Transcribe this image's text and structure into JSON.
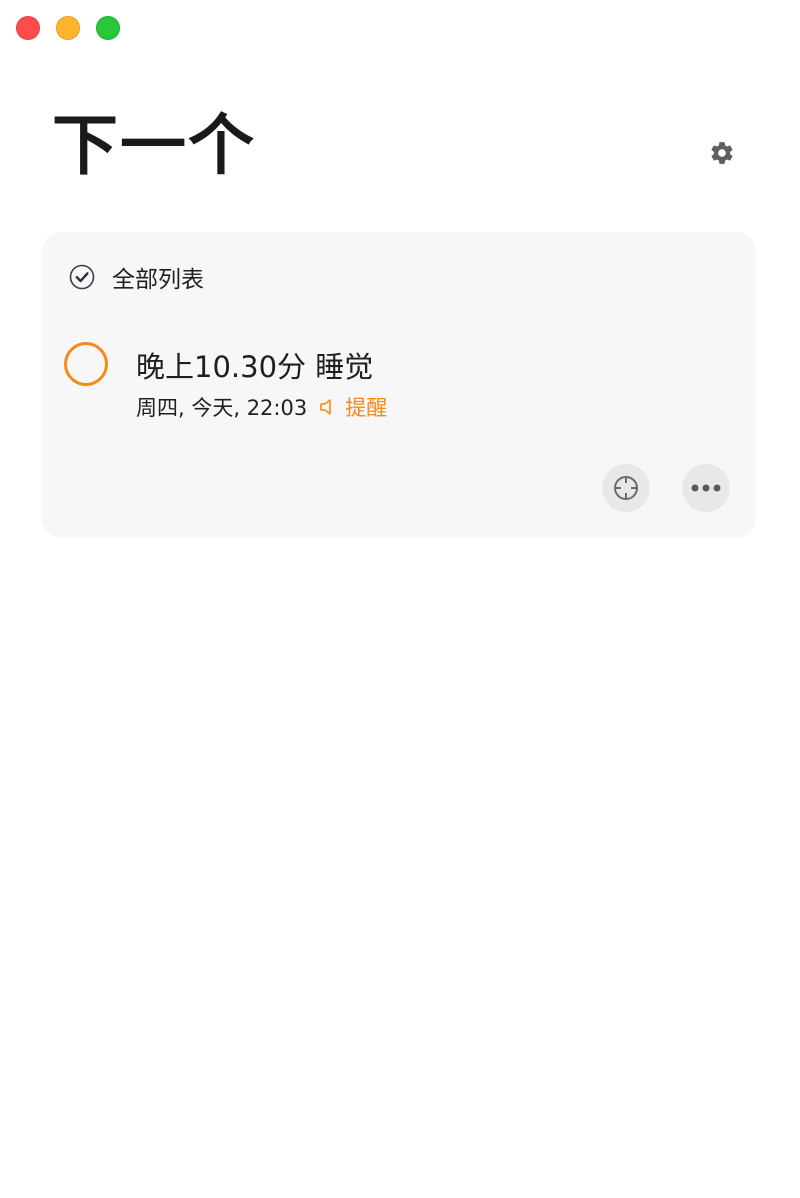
{
  "window": {
    "traffic_lights": {
      "close_color": "#fe4d4a",
      "minimize_color": "#fdb42c",
      "maximize_color": "#2ac73a"
    }
  },
  "header": {
    "title": "下一个",
    "settings_icon": "gear-icon"
  },
  "list": {
    "header_label": "全部列表",
    "header_icon": "check-circle-icon",
    "tasks": [
      {
        "title": "晚上10.30分 睡觉",
        "date_text": "周四, 今天, 22:03",
        "reminder_icon": "speaker-icon",
        "reminder_label": "提醒"
      }
    ]
  },
  "actions": {
    "focus_icon": "crosshair-icon",
    "more_icon": "ellipsis-icon"
  },
  "colors": {
    "accent": "#f7891b",
    "card_background": "#f7f7f7",
    "button_background": "#e8e8e8"
  }
}
